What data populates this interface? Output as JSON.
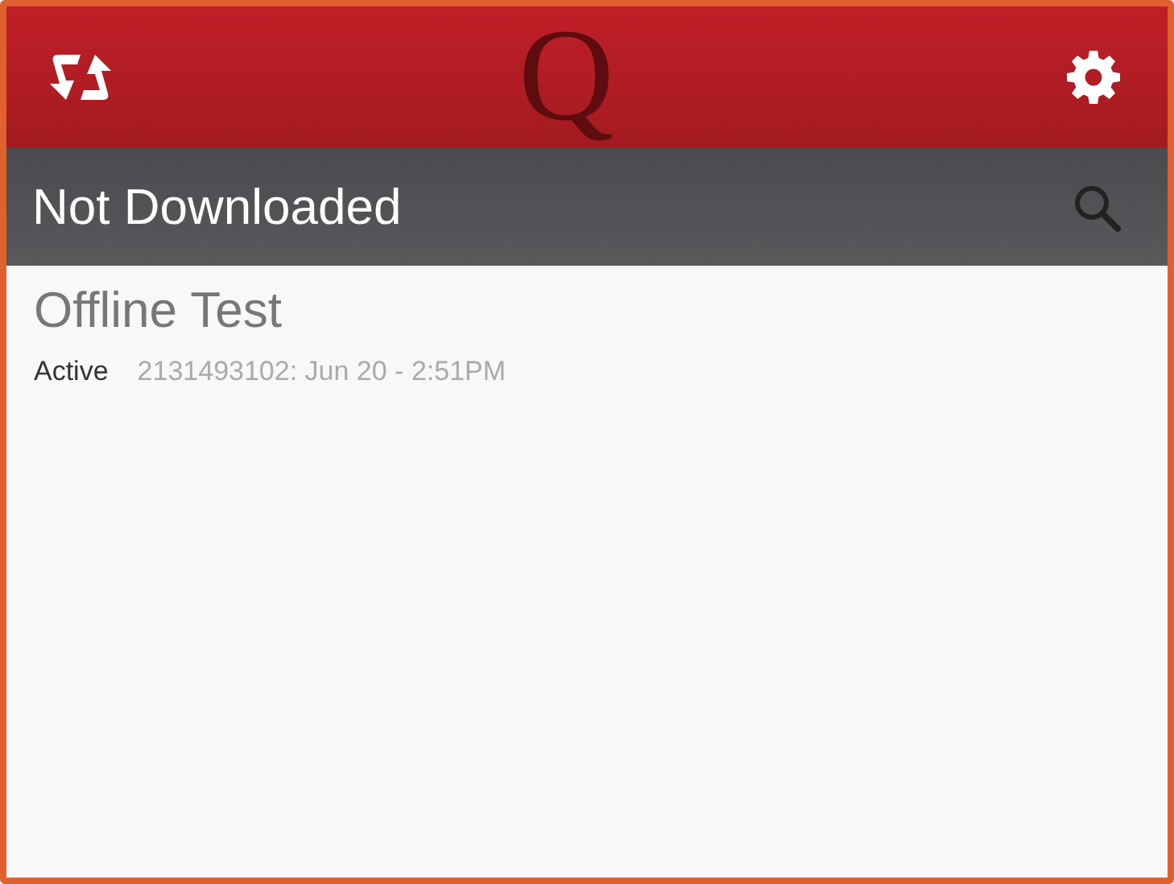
{
  "header": {
    "logo": "Q"
  },
  "section_bar": {
    "title": "Not Downloaded"
  },
  "items": [
    {
      "title": "Offline Test",
      "status": "Active",
      "detail": "2131493102: Jun 20 - 2:51PM"
    }
  ]
}
